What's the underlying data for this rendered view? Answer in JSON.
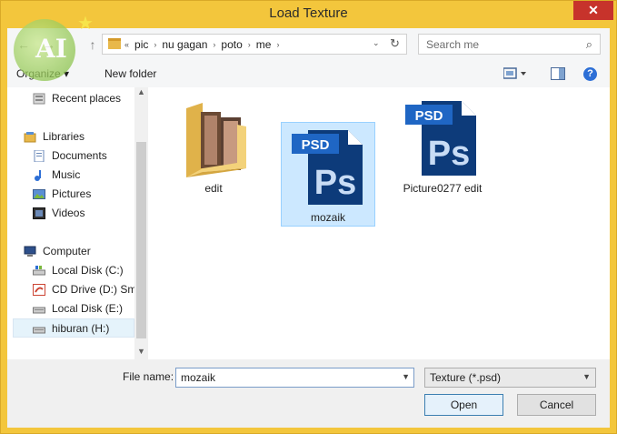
{
  "window": {
    "title": "Load Texture",
    "close_label": "✕"
  },
  "nav": {
    "back_glyph": "←",
    "forward_glyph": "→",
    "up_glyph": "↑"
  },
  "address": {
    "overflow": "«",
    "crumbs": [
      "pic",
      "nu gagan",
      "poto",
      "me"
    ],
    "separator": "›",
    "dropdown_glyph": "⌄",
    "refresh_glyph": "↻"
  },
  "search": {
    "placeholder": "Search me",
    "icon_glyph": "⌕"
  },
  "toolbar": {
    "organize_label": "Organize ▾",
    "new_folder_label": "New folder",
    "help_glyph": "?"
  },
  "sidebar": {
    "items": [
      {
        "label": "Recent places",
        "icon": "recent-places-icon",
        "top": 0
      },
      {
        "label": "Libraries",
        "icon": "libraries-icon",
        "top": 0
      },
      {
        "label": "Documents",
        "icon": "documents-icon",
        "top": 0
      },
      {
        "label": "Music",
        "icon": "music-icon",
        "top": 0
      },
      {
        "label": "Pictures",
        "icon": "pictures-icon",
        "top": 0
      },
      {
        "label": "Videos",
        "icon": "videos-icon",
        "top": 0
      },
      {
        "label": "Computer",
        "icon": "computer-icon",
        "top": 0
      },
      {
        "label": "Local Disk (C:)",
        "icon": "local-disk-icon",
        "top": 0
      },
      {
        "label": "CD Drive (D:) Sm",
        "icon": "cd-drive-icon",
        "top": 0
      },
      {
        "label": "Local Disk (E:)",
        "icon": "local-disk-icon",
        "top": 0
      },
      {
        "label": "hiburan (H:)",
        "icon": "drive-icon",
        "top": 0
      }
    ]
  },
  "files": [
    {
      "name": "edit",
      "type": "folder"
    },
    {
      "name": "mozaik",
      "type": "psd",
      "selected": true
    },
    {
      "name": "Picture0277 edit",
      "type": "psd"
    }
  ],
  "psd_icon_text": {
    "badge": "PSD",
    "logo": "Ps"
  },
  "bottom": {
    "file_name_label": "File name:",
    "file_name_value": "mozaik",
    "file_type_value": "Texture (*.psd)",
    "open_label": "Open",
    "cancel_label": "Cancel"
  },
  "watermark": {
    "text": "AI"
  },
  "colors": {
    "title_bar": "#f3c63c",
    "close": "#c7332b",
    "selection": "#cce8ff",
    "psd_blue": "#0d3b7a"
  }
}
